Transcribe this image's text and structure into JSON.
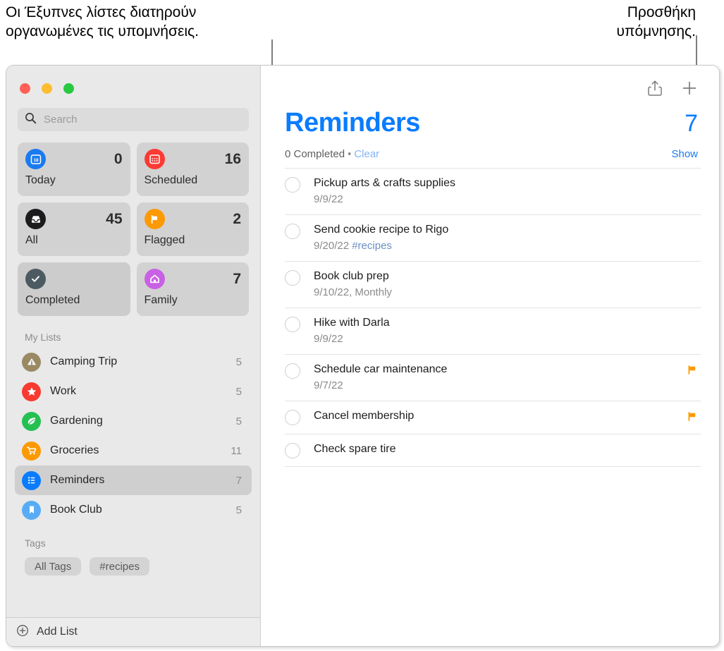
{
  "annotations": {
    "left": "Οι Έξυπνες λίστες διατηρούν\nοργανωμένες τις υπομνήσεις.",
    "right": "Προσθήκη\nυπόμνησης."
  },
  "window": {
    "traffic_lights": [
      "close-button",
      "minimize-button",
      "zoom-button"
    ]
  },
  "sidebar": {
    "search": {
      "placeholder": "Search",
      "value": "",
      "icon": "search-icon"
    },
    "smart_lists": [
      {
        "label": "Today",
        "count": "0",
        "icon": "calendar-day-icon",
        "color": "#1a7af0",
        "selected": false
      },
      {
        "label": "Scheduled",
        "count": "16",
        "icon": "calendar-icon",
        "color": "#fc3a34",
        "selected": false
      },
      {
        "label": "All",
        "count": "45",
        "icon": "inbox-tray-icon",
        "color": "#1c1c1e",
        "selected": false
      },
      {
        "label": "Flagged",
        "count": "2",
        "icon": "flag-icon",
        "color": "#fd9902",
        "selected": false
      },
      {
        "label": "Completed",
        "count": "",
        "icon": "checkmark-icon",
        "color": "#4c5a61",
        "selected": true
      },
      {
        "label": "Family",
        "count": "7",
        "icon": "house-icon",
        "color": "#c861e3",
        "selected": false
      }
    ],
    "my_lists_header": "My Lists",
    "my_lists": [
      {
        "label": "Camping Trip",
        "count": "5",
        "icon": "tent-icon",
        "color": "#9a8a64",
        "selected": false
      },
      {
        "label": "Work",
        "count": "5",
        "icon": "star-icon",
        "color": "#f83a30",
        "selected": false
      },
      {
        "label": "Gardening",
        "count": "5",
        "icon": "leaf-icon",
        "color": "#25c052",
        "selected": false
      },
      {
        "label": "Groceries",
        "count": "11",
        "icon": "cart-icon",
        "color": "#fd9902",
        "selected": false
      },
      {
        "label": "Reminders",
        "count": "7",
        "icon": "list-icon",
        "color": "#0a7cff",
        "selected": true
      },
      {
        "label": "Book Club",
        "count": "5",
        "icon": "bookmark-icon",
        "color": "#58acf5",
        "selected": false
      }
    ],
    "tags_header": "Tags",
    "tags": [
      {
        "label": "All Tags"
      },
      {
        "label": "#recipes"
      }
    ],
    "add_list": {
      "label": "Add List",
      "icon": "plus-circle-icon"
    }
  },
  "main": {
    "toolbar": {
      "share_label": "Share",
      "add_label": "Add Reminder",
      "share_icon": "share-icon",
      "add_icon": "plus-icon"
    },
    "title": "Reminders",
    "count": "7",
    "accent_color": "#0a7cff",
    "meta": {
      "completed_text": "0 Completed",
      "separator": "•",
      "clear_label": "Clear",
      "show_label": "Show"
    },
    "reminders": [
      {
        "title": "Pickup arts & crafts supplies",
        "date": "9/9/22",
        "tag": "",
        "flagged": false
      },
      {
        "title": "Send cookie recipe to Rigo",
        "date": "9/20/22",
        "tag": "#recipes",
        "flagged": false
      },
      {
        "title": "Book club prep",
        "date": "9/10/22, Monthly",
        "tag": "",
        "flagged": false
      },
      {
        "title": "Hike with Darla",
        "date": "9/9/22",
        "tag": "",
        "flagged": false
      },
      {
        "title": "Schedule car maintenance",
        "date": "9/7/22",
        "tag": "",
        "flagged": true
      },
      {
        "title": "Cancel membership",
        "date": "",
        "tag": "",
        "flagged": true
      },
      {
        "title": "Check spare tire",
        "date": "",
        "tag": "",
        "flagged": false
      }
    ],
    "flag_color": "#fd9902"
  }
}
